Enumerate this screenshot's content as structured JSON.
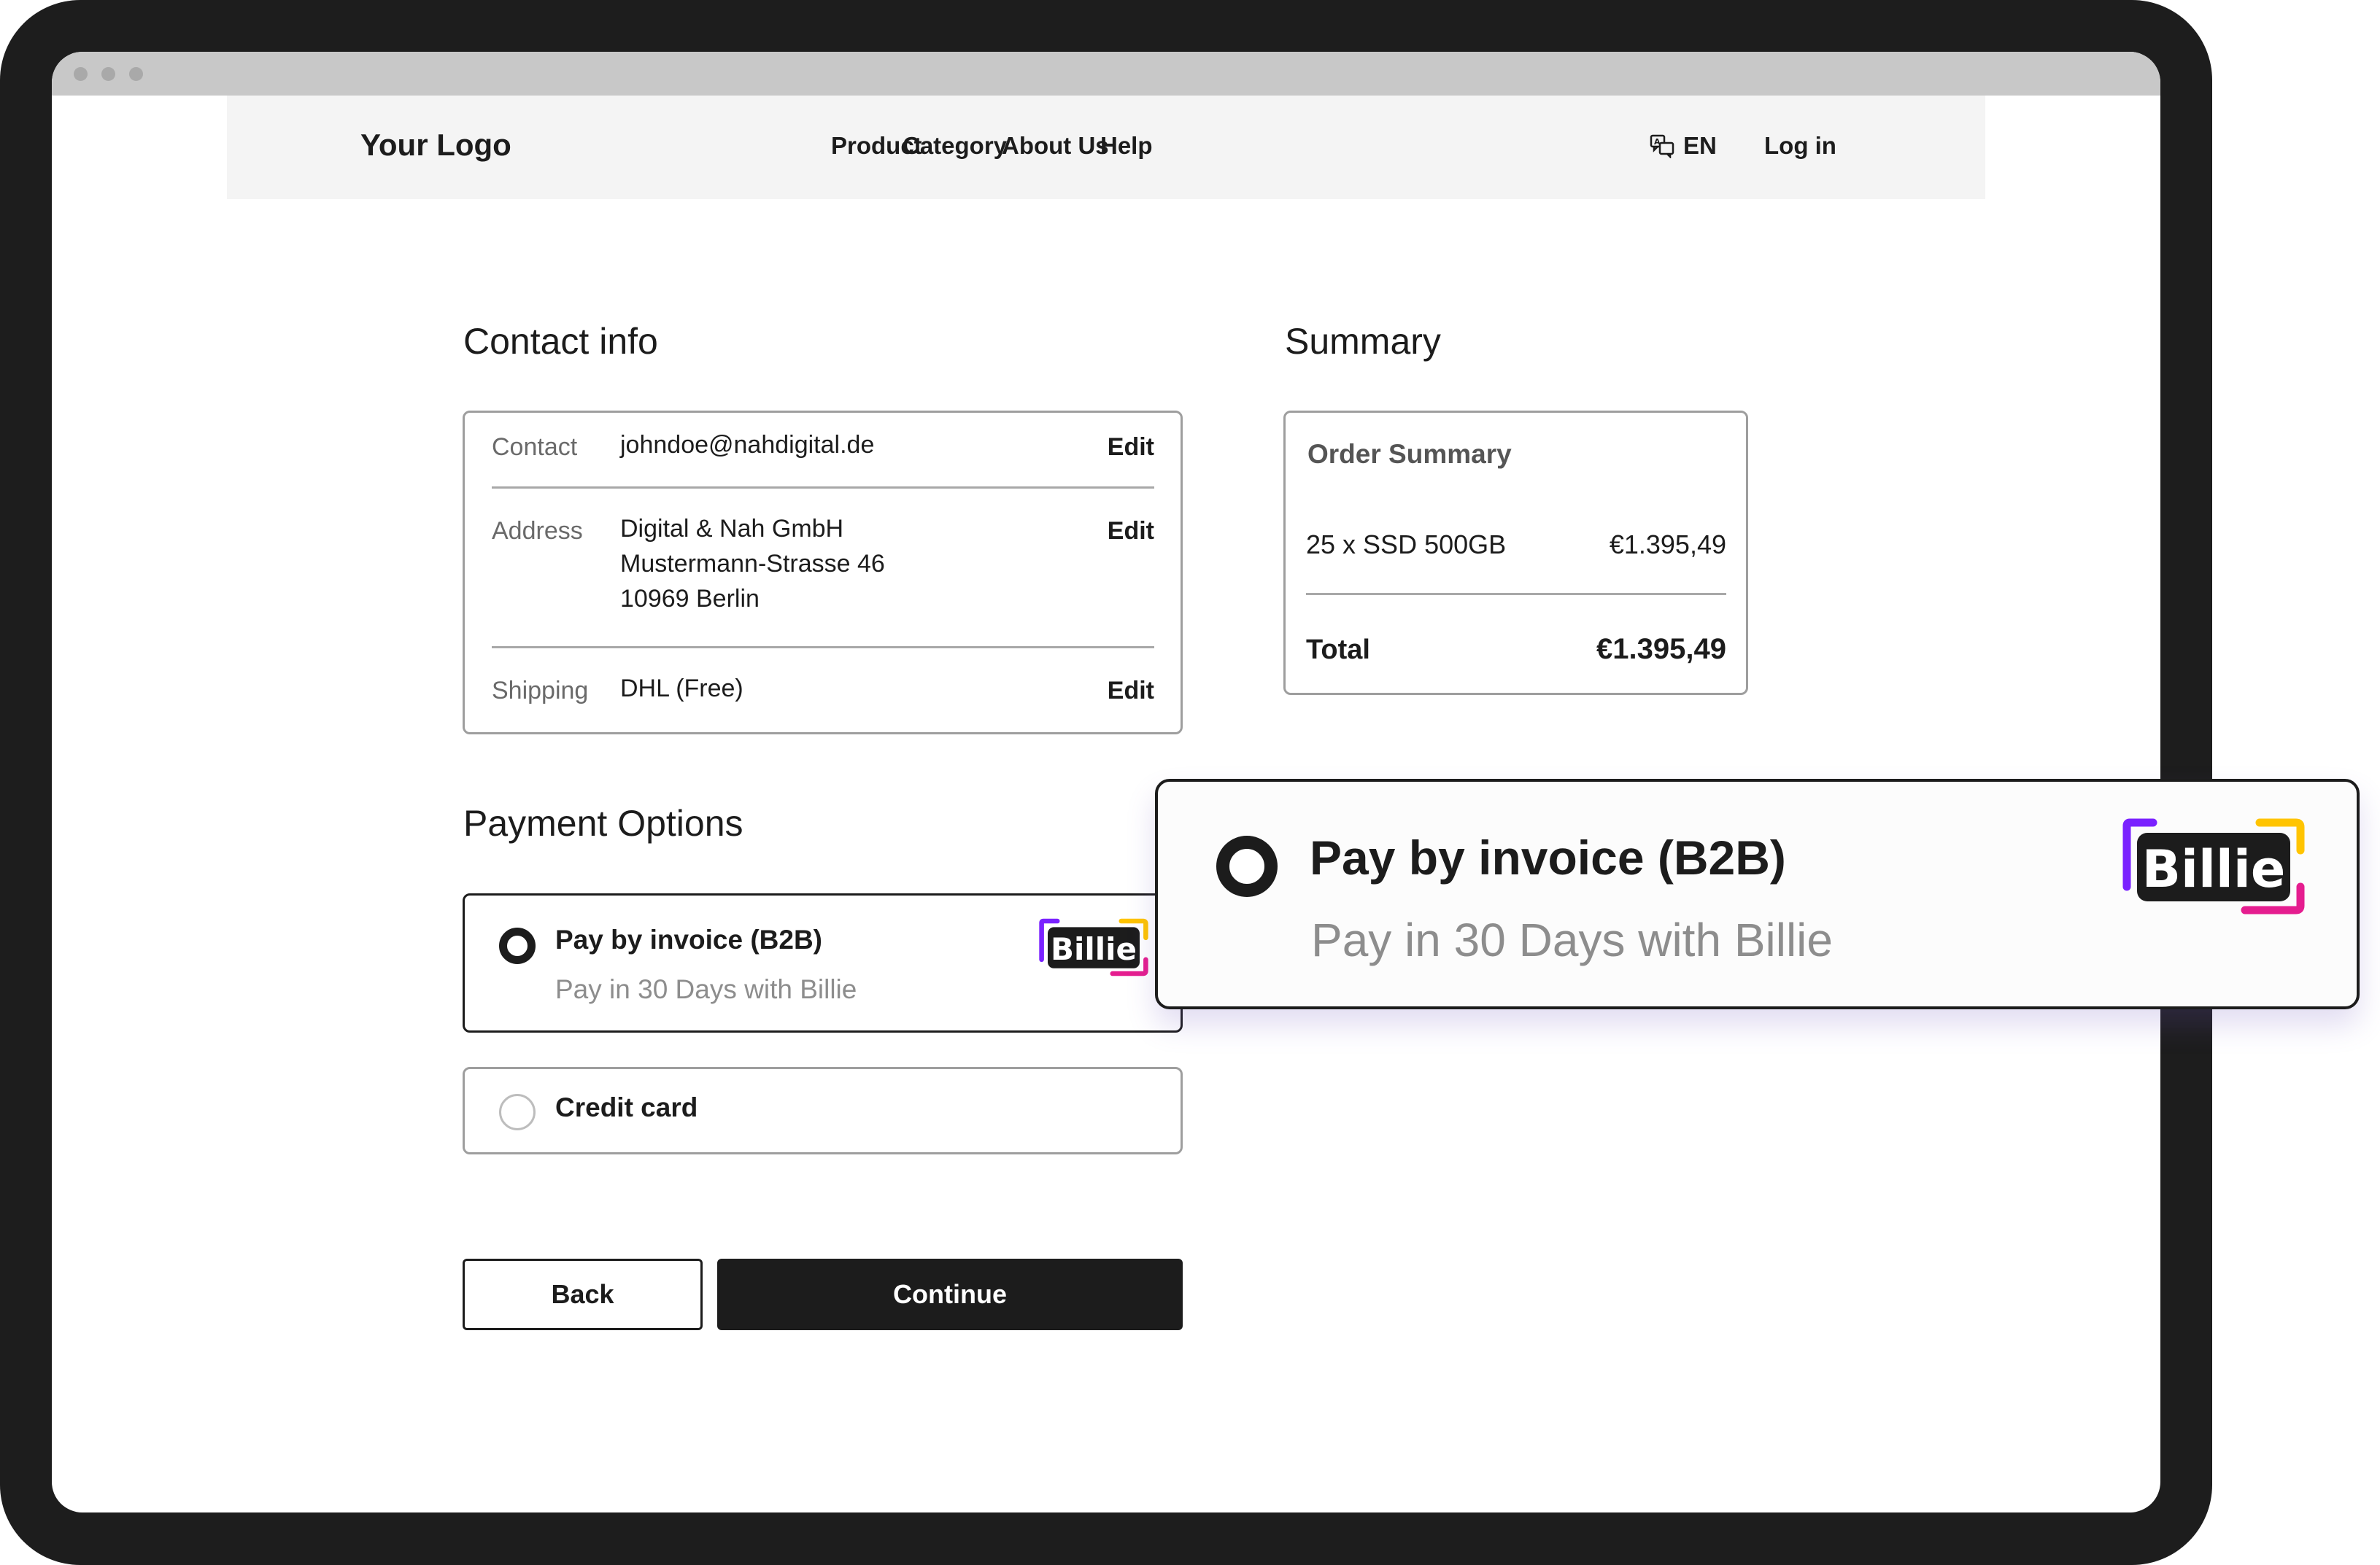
{
  "nav": {
    "logo": "Your Logo",
    "links": [
      "Product",
      "Category",
      "About Us",
      "Help"
    ],
    "language": "EN",
    "login": "Log in"
  },
  "contact": {
    "title": "Contact info",
    "rows": [
      {
        "label": "Contact",
        "value_lines": [
          "johndoe@nahdigital.de"
        ],
        "action": "Edit"
      },
      {
        "label": "Address",
        "value_lines": [
          "Digital & Nah GmbH",
          "Mustermann-Strasse 46",
          "10969 Berlin"
        ],
        "action": "Edit"
      },
      {
        "label": "Shipping",
        "value_lines": [
          "DHL (Free)"
        ],
        "action": "Edit"
      }
    ]
  },
  "summary": {
    "title": "Summary",
    "card_title": "Order Summary",
    "item": {
      "name": "25 x SSD 500GB",
      "price": "€1.395,49"
    },
    "total": {
      "label": "Total",
      "value": "€1.395,49"
    }
  },
  "payment": {
    "title": "Payment Options",
    "options": [
      {
        "title": "Pay by invoice (B2B)",
        "subtitle": "Pay in 30 Days with Billie",
        "selected": true,
        "logo": "Billie"
      },
      {
        "title": "Credit card",
        "selected": false
      }
    ]
  },
  "buttons": {
    "back": "Back",
    "continue": "Continue"
  },
  "popout": {
    "title": "Pay by invoice (B2B)",
    "subtitle": "Pay in 30 Days with Billie",
    "logo": "Billie"
  },
  "colors": {
    "dark": "#1d1d1d",
    "billie_purple": "#7a22ff",
    "billie_yellow": "#ffc400",
    "billie_magenta": "#e51d8f",
    "muted_text": "#8d8d8d"
  }
}
